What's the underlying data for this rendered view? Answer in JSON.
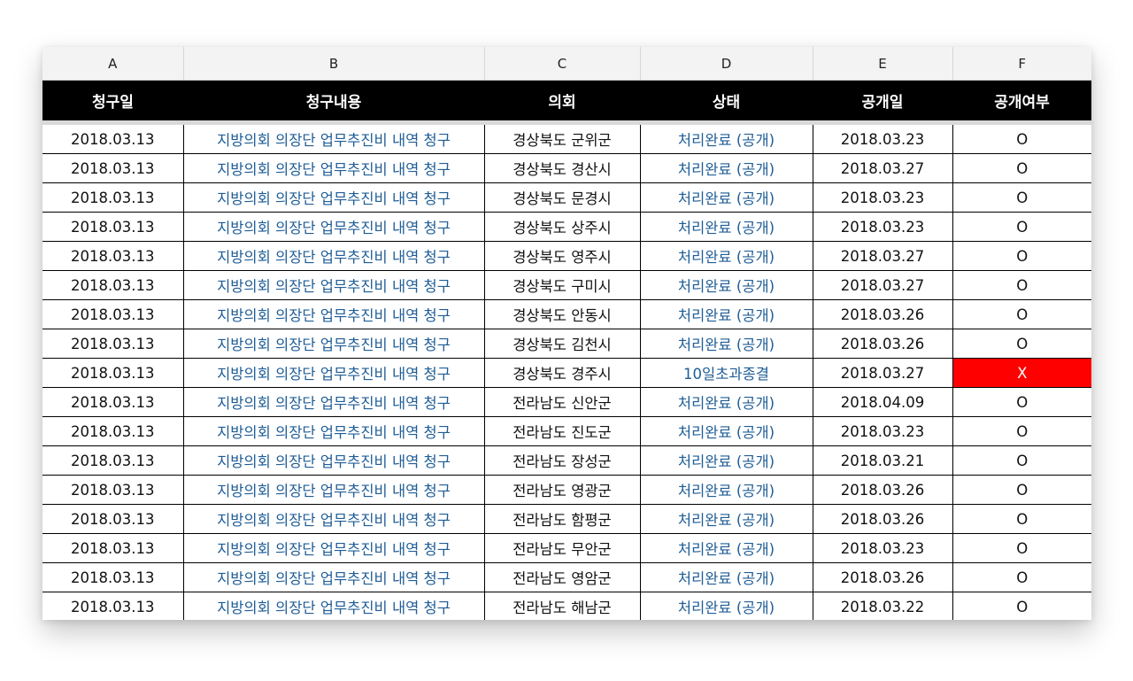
{
  "columns": [
    "A",
    "B",
    "C",
    "D",
    "E",
    "F"
  ],
  "headers": [
    "청구일",
    "청구내용",
    "의회",
    "상태",
    "공개일",
    "공개여부"
  ],
  "colors": {
    "link": "#1f5d96",
    "alert": "#ff0000",
    "header_bg": "#000000"
  },
  "rows": [
    [
      "2018.03.13",
      "지방의회 의장단 업무추진비 내역 청구",
      "경상북도 군위군",
      "처리완료 (공개)",
      "2018.03.23",
      "O"
    ],
    [
      "2018.03.13",
      "지방의회 의장단 업무추진비 내역 청구",
      "경상북도 경산시",
      "처리완료 (공개)",
      "2018.03.27",
      "O"
    ],
    [
      "2018.03.13",
      "지방의회 의장단 업무추진비 내역 청구",
      "경상북도 문경시",
      "처리완료 (공개)",
      "2018.03.23",
      "O"
    ],
    [
      "2018.03.13",
      "지방의회 의장단 업무추진비 내역 청구",
      "경상북도 상주시",
      "처리완료 (공개)",
      "2018.03.23",
      "O"
    ],
    [
      "2018.03.13",
      "지방의회 의장단 업무추진비 내역 청구",
      "경상북도 영주시",
      "처리완료 (공개)",
      "2018.03.27",
      "O"
    ],
    [
      "2018.03.13",
      "지방의회 의장단 업무추진비 내역 청구",
      "경상북도 구미시",
      "처리완료 (공개)",
      "2018.03.27",
      "O"
    ],
    [
      "2018.03.13",
      "지방의회 의장단 업무추진비 내역 청구",
      "경상북도 안동시",
      "처리완료 (공개)",
      "2018.03.26",
      "O"
    ],
    [
      "2018.03.13",
      "지방의회 의장단 업무추진비 내역 청구",
      "경상북도 김천시",
      "처리완료 (공개)",
      "2018.03.26",
      "O"
    ],
    [
      "2018.03.13",
      "지방의회 의장단 업무추진비 내역 청구",
      "경상북도 경주시",
      "10일초과종결",
      "2018.03.27",
      "X"
    ],
    [
      "2018.03.13",
      "지방의회 의장단 업무추진비 내역 청구",
      "전라남도 신안군",
      "처리완료 (공개)",
      "2018.04.09",
      "O"
    ],
    [
      "2018.03.13",
      "지방의회 의장단 업무추진비 내역 청구",
      "전라남도 진도군",
      "처리완료 (공개)",
      "2018.03.23",
      "O"
    ],
    [
      "2018.03.13",
      "지방의회 의장단 업무추진비 내역 청구",
      "전라남도 장성군",
      "처리완료 (공개)",
      "2018.03.21",
      "O"
    ],
    [
      "2018.03.13",
      "지방의회 의장단 업무추진비 내역 청구",
      "전라남도 영광군",
      "처리완료 (공개)",
      "2018.03.26",
      "O"
    ],
    [
      "2018.03.13",
      "지방의회 의장단 업무추진비 내역 청구",
      "전라남도 함평군",
      "처리완료 (공개)",
      "2018.03.26",
      "O"
    ],
    [
      "2018.03.13",
      "지방의회 의장단 업무추진비 내역 청구",
      "전라남도 무안군",
      "처리완료 (공개)",
      "2018.03.23",
      "O"
    ],
    [
      "2018.03.13",
      "지방의회 의장단 업무추진비 내역 청구",
      "전라남도 영암군",
      "처리완료 (공개)",
      "2018.03.26",
      "O"
    ],
    [
      "2018.03.13",
      "지방의회 의장단 업무추진비 내역 청구",
      "전라남도 해남군",
      "처리완료 (공개)",
      "2018.03.22",
      "O"
    ]
  ]
}
